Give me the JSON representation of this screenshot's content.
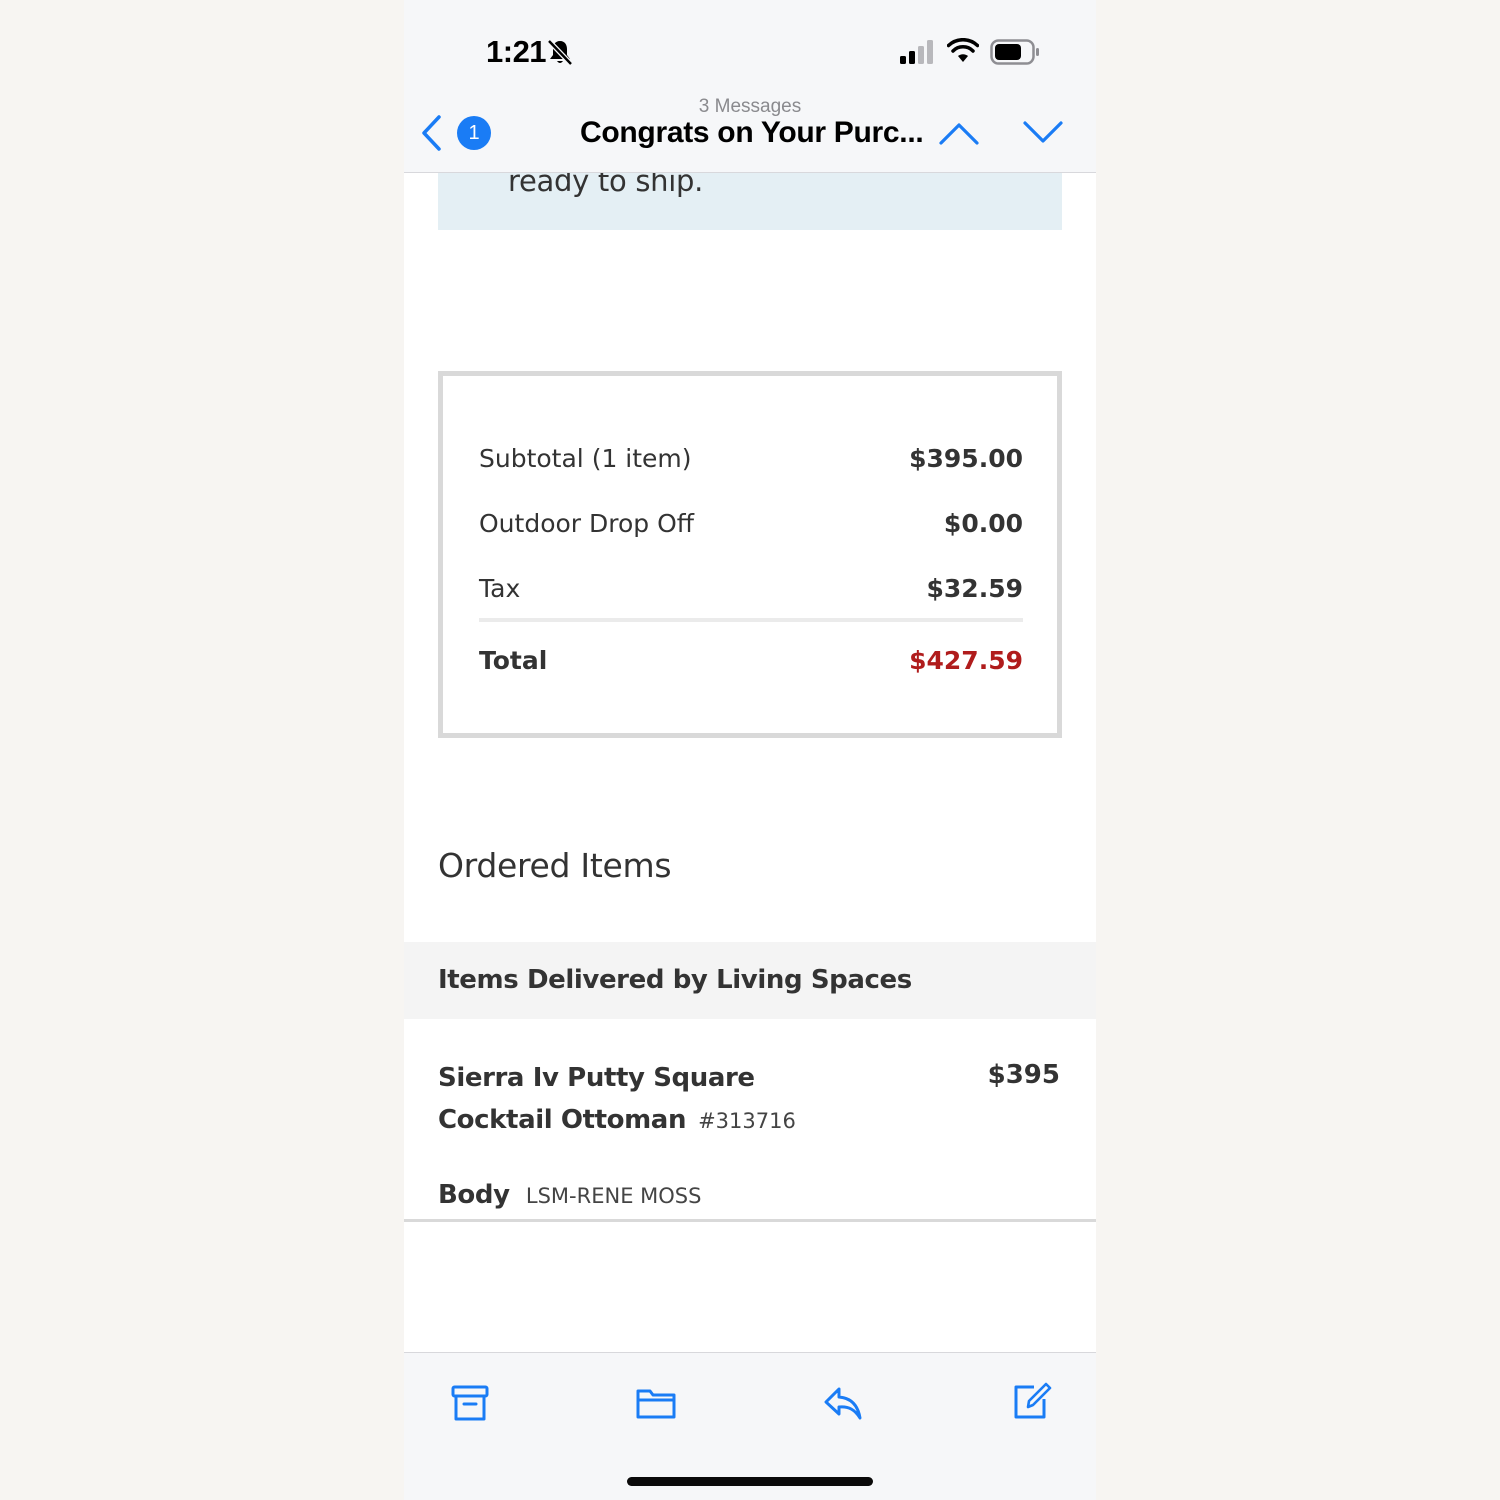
{
  "status_bar": {
    "time": "1:21",
    "icons": [
      "bell-slash-icon",
      "signal-icon",
      "wifi-icon",
      "battery-icon"
    ]
  },
  "nav": {
    "back_badge": "1",
    "subtitle": "3 Messages",
    "title": "Congrats on Your Purc...",
    "icons": [
      "back-chevron-icon",
      "previous-message-icon",
      "next-message-icon"
    ]
  },
  "email": {
    "notice_text": "ready to ship.",
    "summary": {
      "rows": [
        {
          "label": "Subtotal (1 item)",
          "value": "$395.00"
        },
        {
          "label": "Outdoor Drop Off",
          "value": "$0.00"
        },
        {
          "label": "Tax",
          "value": "$32.59"
        }
      ],
      "total_label": "Total",
      "total_value": "$427.59"
    },
    "ordered_title": "Ordered Items",
    "delivered_by": "Items Delivered by Living Spaces",
    "item": {
      "name": "Sierra Iv Putty Square Cocktail Ottoman",
      "sku": "#313716",
      "price": "$395",
      "option_label": "Body",
      "option_value": "LSM-RENE MOSS"
    }
  },
  "toolbar": {
    "icons": [
      "archive-icon",
      "folder-icon",
      "reply-icon",
      "compose-icon"
    ]
  },
  "colors": {
    "accent": "#1a7cf5",
    "total_red": "#b01c1c",
    "notice_bg": "#e4eff4"
  }
}
